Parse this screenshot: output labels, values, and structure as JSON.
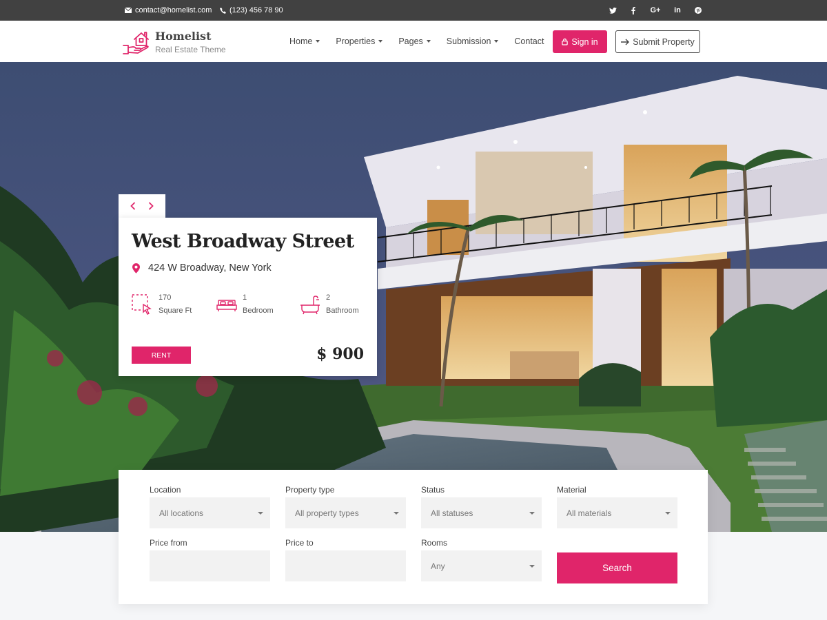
{
  "topbar": {
    "email": "contact@homelist.com",
    "phone": "(123) 456 78 90",
    "socials": [
      "twitter-icon",
      "facebook-icon",
      "google-plus-icon",
      "linkedin-icon",
      "pinterest-icon"
    ]
  },
  "brand": {
    "title": "Homelist",
    "subtitle": "Real Estate Theme"
  },
  "nav": {
    "items": [
      {
        "label": "Home",
        "dropdown": true
      },
      {
        "label": "Properties",
        "dropdown": true
      },
      {
        "label": "Pages",
        "dropdown": true
      },
      {
        "label": "Submission",
        "dropdown": true
      },
      {
        "label": "Contact",
        "dropdown": false
      }
    ],
    "signin_label": "Sign in",
    "submit_label": "Submit Property"
  },
  "listing": {
    "title": "West Broadway Street",
    "address": "424 W Broadway, New York",
    "features": [
      {
        "value": "170",
        "label": "Square Ft",
        "icon": "area-icon"
      },
      {
        "value": "1",
        "label": "Bedroom",
        "icon": "bed-icon"
      },
      {
        "value": "2",
        "label": "Bathroom",
        "icon": "bathtub-icon"
      }
    ],
    "status_label": "RENT",
    "price": "$ 900"
  },
  "search": {
    "fields": [
      {
        "label": "Location",
        "value": "All locations",
        "type": "select"
      },
      {
        "label": "Property type",
        "value": "All property types",
        "type": "select"
      },
      {
        "label": "Status",
        "value": "All statuses",
        "type": "select"
      },
      {
        "label": "Material",
        "value": "All materials",
        "type": "select"
      },
      {
        "label": "Price from",
        "value": "",
        "type": "input"
      },
      {
        "label": "Price to",
        "value": "",
        "type": "input"
      },
      {
        "label": "Rooms",
        "value": "Any",
        "type": "select"
      }
    ],
    "button_label": "Search"
  },
  "colors": {
    "accent": "#e0256a",
    "topbar": "#414141"
  }
}
